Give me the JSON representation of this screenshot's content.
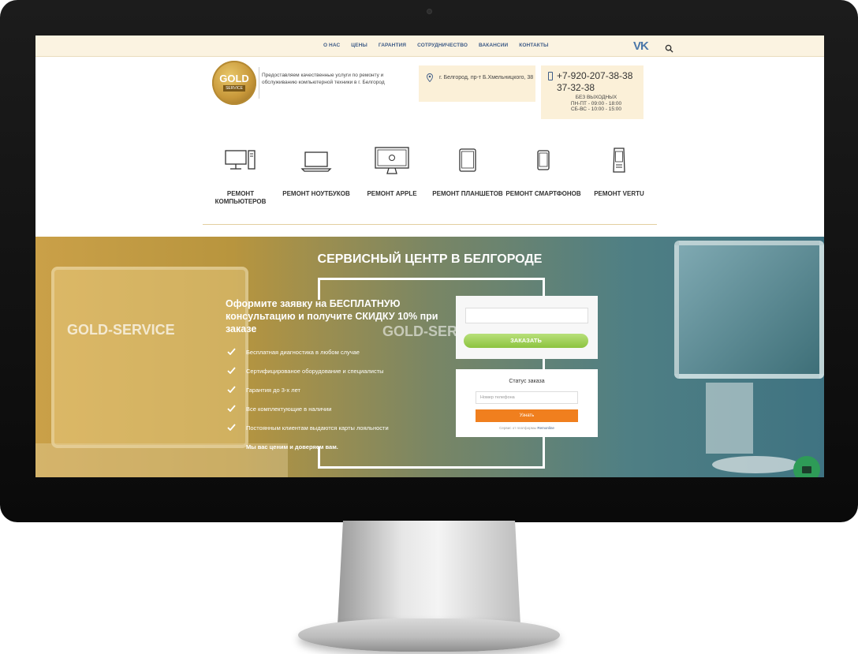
{
  "nav": {
    "links": [
      "О НАС",
      "ЦЕНЫ",
      "ГАРАНТИЯ",
      "СОТРУДНИЧЕСТВО",
      "ВАКАНСИИ",
      "КОНТАКТЫ"
    ],
    "vk_icon": "vk-icon",
    "vk_text": "VK",
    "search_icon": "search-icon"
  },
  "header": {
    "logo": {
      "big": "GOLD",
      "small": "SERVICE"
    },
    "tagline": "Предоставляем качественные услуги по ремонту и обслуживанию компьютерной техники в г. Белгород",
    "address": "г. Белгород, пр-т Б.Хмельницкого, 38",
    "phone": "+7-920-207-38-38 37-32-38",
    "hours_line1": "БЕЗ ВЫХОДНЫХ",
    "hours_line2": "ПН-ПТ - 09:00 - 18:00",
    "hours_line3": "СБ-ВС - 10:00 - 15:00"
  },
  "services": [
    {
      "label": "РЕМОНТ КОМПЬЮТЕРОВ",
      "icon": "desktop-icon"
    },
    {
      "label": "РЕМОНТ НОУТБУКОВ",
      "icon": "laptop-icon"
    },
    {
      "label": "РЕМОНТ APPLE",
      "icon": "apple-icon"
    },
    {
      "label": "РЕМОНТ ПЛАНШЕТОВ",
      "icon": "tablet-icon"
    },
    {
      "label": "РЕМОНТ СМАРТФОНОВ",
      "icon": "smartphone-icon"
    },
    {
      "label": "РЕМОНТ VERTU",
      "icon": "vertu-phone-icon"
    }
  ],
  "hero": {
    "title": "СЕРВИСНЫЙ ЦЕНТР В БЕЛГОРОДЕ",
    "brand_text": "GOLD-SERVICE",
    "offer_title": "Оформите заявку на БЕСПЛАТНУЮ консультацию и получите СКИДКУ 10% при заказе",
    "benefits": [
      "Бесплатная диагностика в любом случае",
      "Сертифицированое оборудование и специалисты",
      "Гарантия до 3-х лет",
      "Все комплектующие в наличии",
      "Постоянным клиентам выдаются карты лояльности"
    ],
    "closing": "Мы вас ценим и доверяем вам.",
    "order_button": "ЗАКАЗАТЬ",
    "status": {
      "title": "Статус заказа",
      "placeholder": "Номер телефона",
      "button": "Узнать",
      "note_prefix": "Сервис от платформы",
      "note_link": "Remonline"
    }
  },
  "colors": {
    "nav_bg": "#fbf3e1",
    "nav_link": "#3d5b87",
    "accent_gold": "#c8983a",
    "order_green": "#8cc33f",
    "status_orange": "#f07f1e",
    "chat_green": "#2e9b57"
  },
  "chat_icon": "chat-envelope-icon"
}
